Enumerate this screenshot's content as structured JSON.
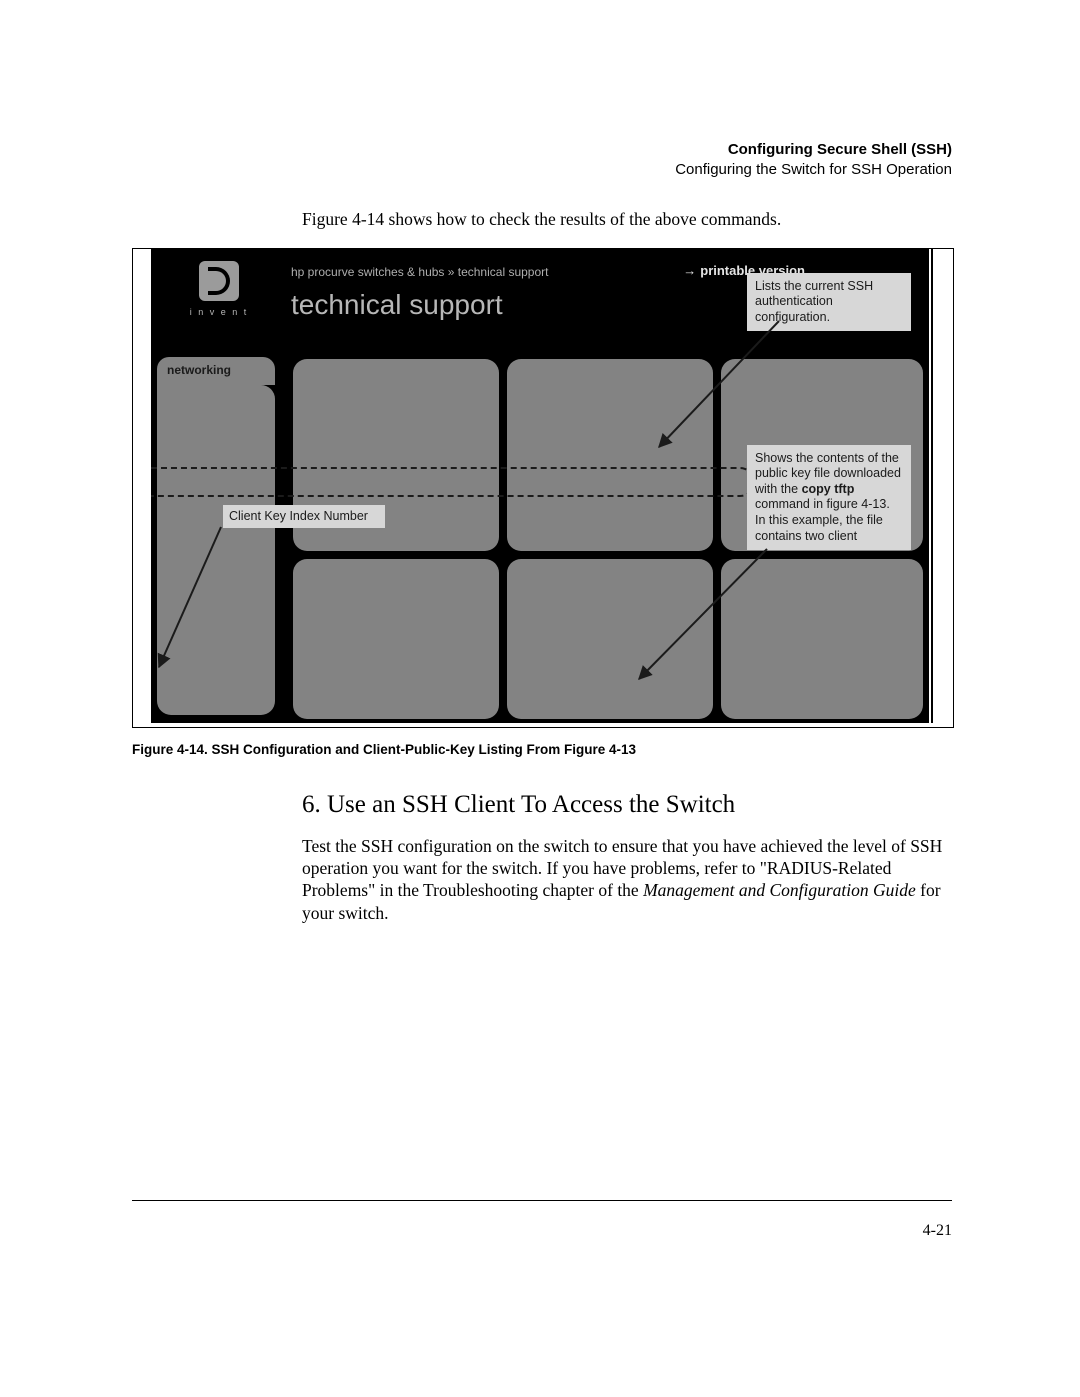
{
  "header": {
    "line1": "Configuring Secure Shell (SSH)",
    "line2": "Configuring the Switch for SSH Operation"
  },
  "intro": "Figure 4-14 shows how to check the results of the above commands.",
  "screenshot": {
    "breadcrumb": "hp procurve switches & hubs » technical support",
    "printable": "printable version",
    "title": "technical support",
    "logo_label": "i n v e n t",
    "tab": "networking"
  },
  "callouts": {
    "top": "Lists the current SSH authentication configuration.",
    "mid_pre": "Shows the contents of the public key file downloaded with the ",
    "mid_bold": "copy tftp",
    "mid_post": " command in figure 4-13. In this example, the file contains two client",
    "key_index": "Client Key Index Number"
  },
  "figcaption": "Figure 4-14. SSH Configuration and Client-Public-Key Listing From Figure 4-13",
  "section_heading": "6. Use an SSH Client To Access the Switch",
  "body": {
    "p1a": "Test the SSH configuration on the switch to ensure that you have achieved the level of SSH operation you want for the switch. If you have problems, refer to \"RADIUS-Related Problems\" in the Troubleshooting chapter of the ",
    "p1_it": "Management and Configuration Guide",
    "p1b": " for your switch."
  },
  "page_number": "4-21"
}
